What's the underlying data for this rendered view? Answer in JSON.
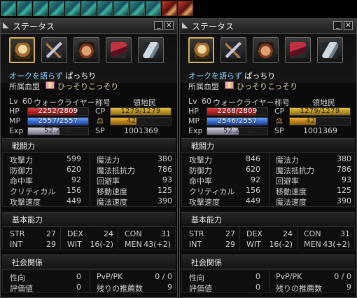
{
  "buffs": [
    "blue",
    "blue",
    "blue",
    "blue",
    "blue",
    "blue",
    "blue",
    "blue",
    "blue",
    "blue",
    "red",
    "red"
  ],
  "panels": [
    {
      "title": "ステータス",
      "title_name": "オークを語らず",
      "char_name": "ぱっちり",
      "clan_label": "所属血盟",
      "clan_name": "ひっそりこっそり",
      "lv_label": "Lv",
      "level": "60",
      "class": "ウォークライヤー",
      "title_label": "称号",
      "title_value": "領地民",
      "hp_label": "HP",
      "hp_text": "2252/2809",
      "hp_frac": 0.8,
      "mp_label": "MP",
      "mp_text": "2557/2557",
      "mp_frac": 1.0,
      "exp_label": "Exp",
      "exp_text": "52.27%",
      "exp_frac": 0.5227,
      "cp_label": "CP",
      "cp_text": "1279/1279",
      "cp_frac": 1.0,
      "weight_text": "42.94%",
      "weight_frac": 0.4294,
      "sp_label": "SP",
      "sp": "1001369",
      "combat_title": "戦闘力",
      "combat": [
        [
          "攻撃力",
          "599",
          "魔法力",
          "380"
        ],
        [
          "防御力",
          "620",
          "魔法抵抗力",
          "786"
        ],
        [
          "命中率",
          "92",
          "回避率",
          "93"
        ],
        [
          "クリティカル",
          "156",
          "移動速度",
          "125"
        ],
        [
          "攻撃速度",
          "449",
          "魔法速度",
          "390"
        ]
      ],
      "basic_title": "基本能力",
      "basic": [
        [
          "STR",
          "27",
          "DEX",
          "24",
          "CON",
          "31"
        ],
        [
          "INT",
          "29",
          "WIT",
          "16(-2)",
          "MEN",
          "43(+2)"
        ]
      ],
      "social_title": "社会関係",
      "social": [
        [
          "性向",
          "0",
          "PvP/PK",
          "0 / 0"
        ],
        [
          "評価値",
          "0",
          "残りの推薦数",
          "9"
        ]
      ]
    },
    {
      "title": "ステータス",
      "title_name": "オークを語らず",
      "char_name": "ぱっちり",
      "clan_label": "所属血盟",
      "clan_name": "ひっそりこっそり",
      "lv_label": "Lv",
      "level": "60",
      "class": "ウォークライヤー",
      "title_label": "称号",
      "title_value": "領地民",
      "hp_label": "HP",
      "hp_text": "2268/2809",
      "hp_frac": 0.81,
      "mp_label": "MP",
      "mp_text": "2546/2557",
      "mp_frac": 0.995,
      "exp_label": "Exp",
      "exp_text": "52.27%",
      "exp_frac": 0.5227,
      "cp_label": "CP",
      "cp_text": "1279/1279",
      "cp_frac": 1.0,
      "weight_text": "42.94%",
      "weight_frac": 0.4294,
      "sp_label": "SP",
      "sp": "1001369",
      "combat_title": "戦闘力",
      "combat": [
        [
          "攻撃力",
          "846",
          "魔法力",
          "380"
        ],
        [
          "防御力",
          "620",
          "魔法抵抗力",
          "786"
        ],
        [
          "命中率",
          "92",
          "回避率",
          "93"
        ],
        [
          "クリティカル",
          "156",
          "移動速度",
          "125"
        ],
        [
          "攻撃速度",
          "449",
          "魔法速度",
          "390"
        ]
      ],
      "basic_title": "基本能力",
      "basic": [
        [
          "STR",
          "27",
          "DEX",
          "24",
          "CON",
          "31"
        ],
        [
          "INT",
          "29",
          "WIT",
          "16(-2)",
          "MEN",
          "43(+2)"
        ]
      ],
      "social_title": "社会関係",
      "social": [
        [
          "性向",
          "0",
          "PvP/PK",
          "0 / 0"
        ],
        [
          "評価値",
          "0",
          "残りの推薦数",
          "9"
        ]
      ]
    }
  ],
  "tab_icons": [
    "face-icon",
    "weapon-icon",
    "fist-icon",
    "flag-icon",
    "horn-icon"
  ],
  "colors": {
    "accent_tab": "#d7b04a",
    "name_title": "#8fd3ff",
    "hp": "#c02020",
    "mp": "#2a5ad0",
    "cp": "#c8a030"
  }
}
